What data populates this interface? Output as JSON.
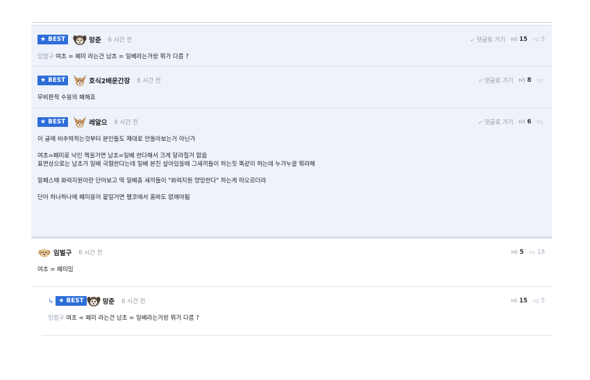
{
  "comments": [
    {
      "best_label": "BEST",
      "nick": "망준",
      "time": "6 시간 전",
      "reply_link": "댓글로 가기",
      "up": "15",
      "down": "5",
      "mention": "임벌구",
      "text": "여초 = 페미 라는건 남초 = 일베라는거랑 뭐가 다름 ?"
    },
    {
      "best_label": "BEST",
      "nick": "호식2배운간장",
      "time": "6 시간 전",
      "reply_link": "댓글로 가기",
      "up": "8",
      "down": "",
      "text": "무비판적 수용의 폐해죠"
    },
    {
      "best_label": "BEST",
      "nick": "레알으",
      "time": "6 시간 전",
      "reply_link": "댓글로 가기",
      "up": "6",
      "down": "",
      "paragraphs": [
        "이 글에 비추박히는것부터 본인들도 제대로 안돌아보는거 아닌가",
        "여초=페미로 낙인 찍을거면 남초=일베 한다해서 크게 달라질거 없음",
        "표면상으로는 남초가 일베 극혐한다는데 일베 본진 살아있을때 그새끼들이 하는짓 똑같이 하는데 누가누굴 뭐라해",
        "알페스때 화력지원이란 단어보고 딱 일베충 새끼들이 \"화력지원 양망한다\" 하는게 떠오르더라",
        "단어 하나하나에 페미용어 붙일거면 펨코에서 홈바도 없애야됨"
      ]
    },
    {
      "nick": "임벌구",
      "time": "6 시간 전",
      "up": "5",
      "down": "18",
      "text": "여초 = 페미임"
    },
    {
      "best_label": "BEST",
      "nick": "망준",
      "time": "6 시간 전",
      "up": "15",
      "down": "5",
      "mention": "임벌구",
      "text": "여초 = 페미 라는건 남초 = 일베라는거랑 뭐가 다름 ?"
    }
  ],
  "colors": {
    "best_bg": "#2e6dd8",
    "best_row_bg": "#edf2fb"
  }
}
